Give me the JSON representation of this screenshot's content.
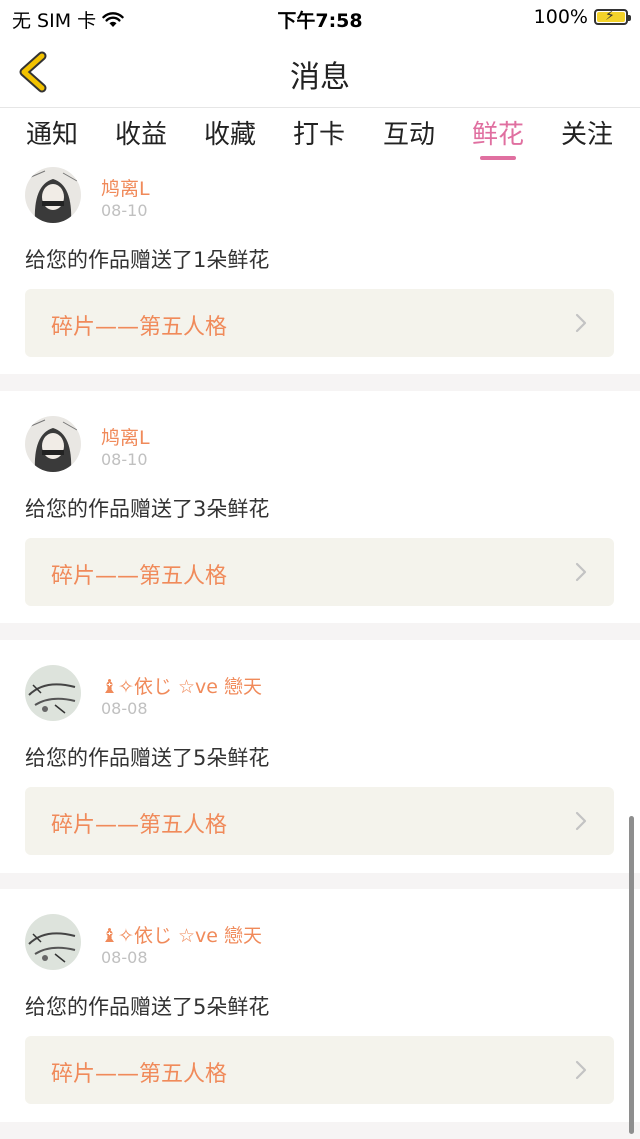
{
  "status": {
    "carrier": "无 SIM 卡",
    "time": "下午7:58",
    "battery": "100%"
  },
  "nav": {
    "title": "消息"
  },
  "tabs": [
    {
      "label": "通知"
    },
    {
      "label": "收益"
    },
    {
      "label": "收藏"
    },
    {
      "label": "打卡"
    },
    {
      "label": "互动"
    },
    {
      "label": "鲜花"
    },
    {
      "label": "关注"
    }
  ],
  "active_tab": "鲜花",
  "messages": [
    {
      "user": "鸠离L",
      "date": "08-10",
      "text": "给您的作品赠送了1朵鲜花",
      "work": "碎片——第五人格",
      "avatar": "girl-avatar"
    },
    {
      "user": "鸠离L",
      "date": "08-10",
      "text": "给您的作品赠送了3朵鲜花",
      "work": "碎片——第五人格",
      "avatar": "girl-avatar"
    },
    {
      "user": "♝✧依じ ☆ve 戀天",
      "date": "08-08",
      "text": "给您的作品赠送了5朵鲜花",
      "work": "碎片——第五人格",
      "avatar": "sketch-avatar"
    },
    {
      "user": "♝✧依じ ☆ve 戀天",
      "date": "08-08",
      "text": "给您的作品赠送了5朵鲜花",
      "work": "碎片——第五人格",
      "avatar": "sketch-avatar"
    }
  ],
  "colors": {
    "accent": "#e06fa0",
    "name": "#f08a5a",
    "back": "#f2c200"
  }
}
